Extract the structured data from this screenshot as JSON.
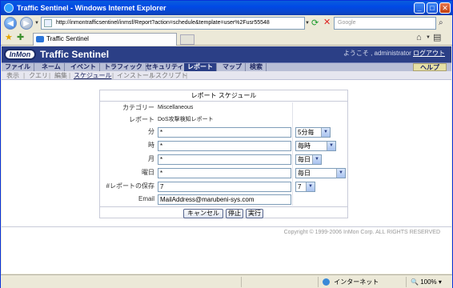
{
  "window": {
    "title": "Traffic Sentinel - Windows Internet Explorer"
  },
  "browser": {
    "url": "http://inmontrafficsentinel/inmsf/Report?action=schedule&template=user%2Fusr55548",
    "search_placeholder": "Google",
    "tab_title": "Traffic Sentinel",
    "status_zone": "インターネット",
    "zoom": "100%"
  },
  "app": {
    "logo_text": "InMon",
    "brand": "Traffic Sentinel",
    "welcome_prefix": "ようこそ , administrator",
    "logout": "ログアウト",
    "menu": [
      "ファイル",
      "ネーム",
      "イベント",
      "トラフィック",
      "セキュリティ",
      "レポート",
      "マップ",
      "検索"
    ],
    "active_menu": "レポート",
    "help": "ヘルプ",
    "submenu": [
      "表示",
      "クエリ",
      "編集",
      "スケジュール",
      "インストール",
      "スクリプト"
    ],
    "active_submenu": "スケジュール"
  },
  "form": {
    "title": "レポート スケジュール",
    "category_label": "カテゴリー",
    "category_value": "Miscellaneous",
    "report_label": "レポート",
    "report_value": "DoS攻撃検知レポート",
    "minute_label": "分",
    "minute_value": "*",
    "minute_select": "5分毎",
    "hour_label": "時",
    "hour_value": "*",
    "hour_select": "毎時",
    "month_label": "月",
    "month_value": "*",
    "month_select": "毎日",
    "weekday_label": "曜日",
    "weekday_value": "*",
    "weekday_select": "毎日",
    "keep_label": "#レポートの保存",
    "keep_value": "7",
    "keep_select": "7",
    "email_label": "Email",
    "email_value": "MailAddress@marubeni-sys.com",
    "cancel_label": "キャンセル",
    "stop_label": "停止",
    "run_label": "実行"
  },
  "footer": {
    "copyright": "Copyright © 1999-2006 InMon Corp. ALL RIGHTS RESERVED"
  }
}
